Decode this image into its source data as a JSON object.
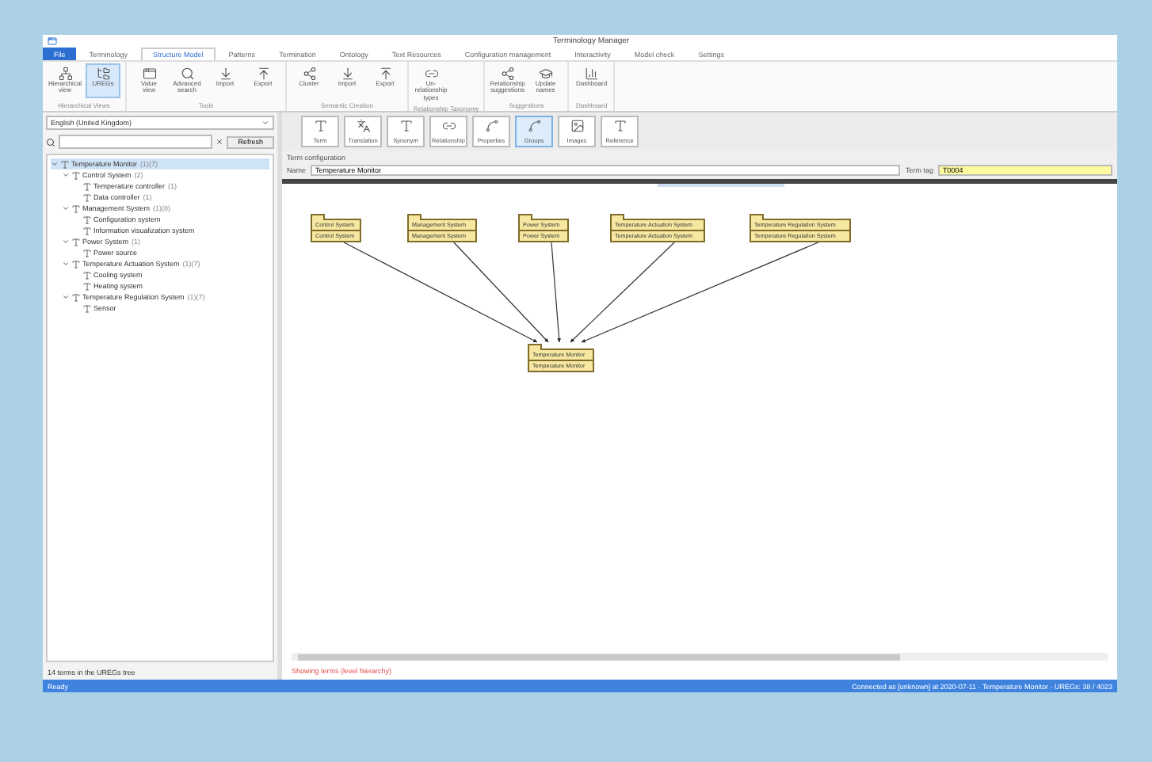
{
  "window": {
    "title": "Terminology Manager"
  },
  "tabs": [
    {
      "label": "File",
      "selected": false,
      "kind": "file"
    },
    {
      "label": "Terminology",
      "selected": false,
      "kind": "tab"
    },
    {
      "label": "Structure Model",
      "selected": true,
      "kind": "tab"
    },
    {
      "label": "Patterns",
      "selected": false,
      "kind": "tab"
    },
    {
      "label": "Termination",
      "selected": false,
      "kind": "tab"
    },
    {
      "label": "Ontology",
      "selected": false,
      "kind": "tab"
    },
    {
      "label": "Text Resources",
      "selected": false,
      "kind": "tab"
    },
    {
      "label": "Configuration management",
      "selected": false,
      "kind": "tab"
    },
    {
      "label": "Interactivity",
      "selected": false,
      "kind": "tab"
    },
    {
      "label": "Model check",
      "selected": false,
      "kind": "tab"
    },
    {
      "label": "Settings",
      "selected": false,
      "kind": "tab"
    }
  ],
  "ribbon": [
    {
      "group": "Hierarchical Views",
      "buttons": [
        {
          "label": "Hierarchical view",
          "selected": false
        },
        {
          "label": "UREGs",
          "selected": true
        }
      ]
    },
    {
      "group": "Tools",
      "buttons": [
        {
          "label": "Value view",
          "selected": false
        },
        {
          "label": "Advanced search",
          "selected": false
        },
        {
          "label": "Import",
          "selected": false
        },
        {
          "label": "Export",
          "selected": false
        }
      ]
    },
    {
      "group": "Semantic Creation",
      "buttons": [
        {
          "label": "Cluster",
          "selected": false
        },
        {
          "label": "Import",
          "selected": false
        },
        {
          "label": "Export",
          "selected": false
        }
      ]
    },
    {
      "group": "Relationship Taxonomy",
      "buttons": [
        {
          "label": "Un-relationship types",
          "selected": false
        }
      ]
    },
    {
      "group": "Suggestions",
      "buttons": [
        {
          "label": "Relationship suggestions",
          "selected": false
        },
        {
          "label": "Update names",
          "selected": false
        }
      ]
    },
    {
      "group": "Dashboard",
      "buttons": [
        {
          "label": "Dashboard",
          "selected": false
        }
      ]
    }
  ],
  "sidebar": {
    "language": "English (United Kingdom)",
    "refresh": "Refresh",
    "tree": [
      {
        "label": "Temperature Monitor",
        "count": "(1)(7)",
        "selected": true,
        "expanded": true,
        "children": [
          {
            "label": "Control System",
            "count": "(2)",
            "selected": false,
            "expanded": true,
            "children": [
              {
                "label": "Temperature controller",
                "count": "(1)",
                "selected": false
              },
              {
                "label": "Data controller",
                "count": "(1)",
                "selected": false
              }
            ]
          },
          {
            "label": "Management System",
            "count": "(1)(8)",
            "selected": false,
            "expanded": true,
            "children": [
              {
                "label": "Configuration system",
                "selected": false
              },
              {
                "label": "Information visualization system",
                "selected": false
              }
            ]
          },
          {
            "label": "Power System",
            "count": "(1)",
            "selected": false,
            "expanded": true,
            "children": [
              {
                "label": "Power source",
                "selected": false
              }
            ]
          },
          {
            "label": "Temperature Actuation System",
            "count": "(1)(7)",
            "selected": false,
            "expanded": true,
            "children": [
              {
                "label": "Cooling system",
                "selected": false
              },
              {
                "label": "Heating system",
                "selected": false
              }
            ]
          },
          {
            "label": "Temperature Regulation System",
            "count": "(1)(7)",
            "selected": false,
            "expanded": true,
            "children": [
              {
                "label": "Sensor",
                "selected": false
              }
            ]
          }
        ]
      }
    ],
    "footer": "14 terms in the UREGs tree"
  },
  "toolbar": [
    {
      "label": "Term",
      "selected": false
    },
    {
      "label": "Translation",
      "selected": false
    },
    {
      "label": "Synonym",
      "selected": false
    },
    {
      "label": "Relationship",
      "selected": false
    },
    {
      "label": "Properties",
      "selected": false
    },
    {
      "label": "Groups",
      "selected": true
    },
    {
      "label": "Images",
      "selected": false
    },
    {
      "label": "Reference",
      "selected": false
    }
  ],
  "term_configuration": {
    "title": "Term configuration",
    "name_label": "Name",
    "name": "Temperature Monitor",
    "tag_label": "Term tag",
    "tag": "T0004"
  },
  "diagram": {
    "packages": [
      {
        "name": "Control System",
        "subtitle": "Control System"
      },
      {
        "name": "Management System",
        "subtitle": "Management System"
      },
      {
        "name": "Power System",
        "subtitle": "Power System"
      },
      {
        "name": "Temperature Actuation System",
        "subtitle": "Temperature Actuation System"
      },
      {
        "name": "Temperature Regulation System",
        "subtitle": "Temperature Regulation System"
      }
    ],
    "root": {
      "name": "Temperature Monitor",
      "subtitle": "Temperature Monitor"
    }
  },
  "message": "Showing terms (level hierarchy)",
  "status_bar": {
    "left": "Ready",
    "right": "Connected as [unknown] at 2020-07-11 · Temperature Monitor · UREGs: 38 / 4023"
  }
}
